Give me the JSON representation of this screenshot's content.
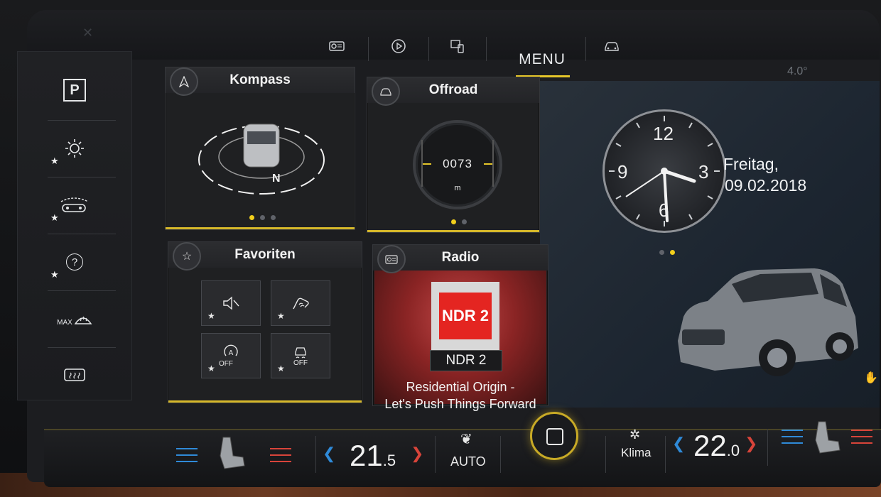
{
  "topbar": {
    "menu_label": "MENU",
    "outside_temp": "4.0°"
  },
  "tiles": {
    "kompass": {
      "title": "Kompass",
      "heading": "N"
    },
    "offroad": {
      "title": "Offroad",
      "value": "0073",
      "unit": "m"
    },
    "favoriten": {
      "title": "Favoriten",
      "buttons": [
        {
          "label": ""
        },
        {
          "label": ""
        },
        {
          "label": "OFF"
        },
        {
          "label": "OFF"
        }
      ]
    },
    "radio": {
      "title": "Radio",
      "logo": "NDR 2",
      "station": "NDR 2",
      "song_line1": "Residential Origin -",
      "song_line2": "Let's Push Things Forward"
    }
  },
  "sidebar": {
    "items": [
      {
        "label": "P"
      },
      {
        "label": ""
      },
      {
        "label": ""
      },
      {
        "label": "?"
      },
      {
        "label": "MAX"
      },
      {
        "label": ""
      }
    ]
  },
  "clock": {
    "numerals": [
      "12",
      "3",
      "6",
      "9"
    ],
    "day": "Freitag,",
    "date": "09.02.2018"
  },
  "climate": {
    "left_temp_int": "21",
    "left_temp_dec": ".5",
    "right_temp_int": "22",
    "right_temp_dec": ".0",
    "auto_label": "AUTO",
    "klima_label": "Klima"
  },
  "colors": {
    "accent": "#e5c62a",
    "cold": "#2f8ad8",
    "warm": "#d8443a"
  }
}
